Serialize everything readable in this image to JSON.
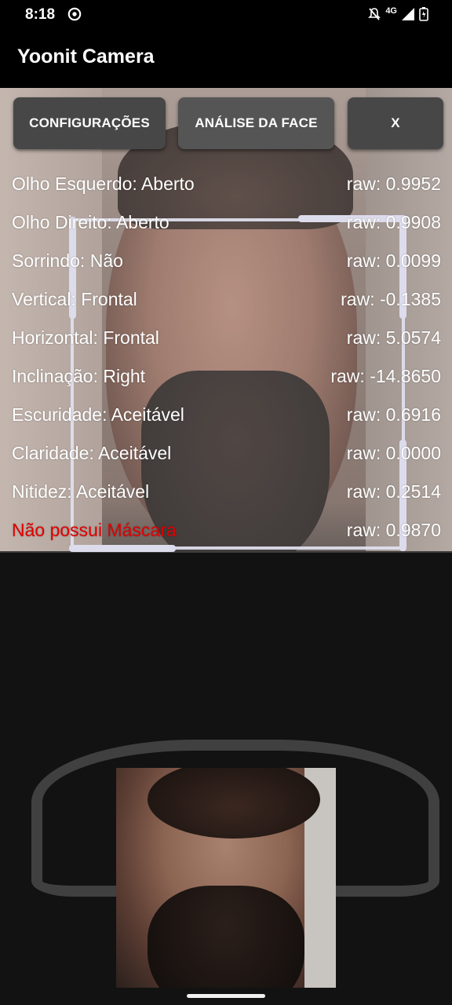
{
  "status_bar": {
    "time": "8:18",
    "network": "4G"
  },
  "app_bar": {
    "title": "Yoonit Camera"
  },
  "buttons": {
    "config": "CONFIGURAÇÕES",
    "face_analysis": "ANÁLISE DA FACE",
    "close": "X"
  },
  "metrics": [
    {
      "label": "Olho Esquerdo: Aberto",
      "raw": "raw: 0.9952"
    },
    {
      "label": "Olho Direito: Aberto",
      "raw": "raw: 0.9908"
    },
    {
      "label": "Sorrindo: Não",
      "raw": "raw: 0.0099"
    },
    {
      "label": "Vertical: Frontal",
      "raw": "raw: -0.1385"
    },
    {
      "label": "Horizontal: Frontal",
      "raw": "raw: 5.0574"
    },
    {
      "label": "Inclinação: Right",
      "raw": "raw: -14.8650"
    },
    {
      "label": "Escuridade: Aceitável",
      "raw": "raw: 0.6916"
    },
    {
      "label": "Claridade: Aceitável",
      "raw": "raw: 0.0000"
    },
    {
      "label": "Nitidez: Aceitável",
      "raw": "raw: 0.2514"
    },
    {
      "label": "Não possui Máscara",
      "raw": "raw: 0.9870"
    }
  ],
  "colors": {
    "alert": "#e00000",
    "button": "#474747",
    "face_box": "#dcdcec"
  }
}
